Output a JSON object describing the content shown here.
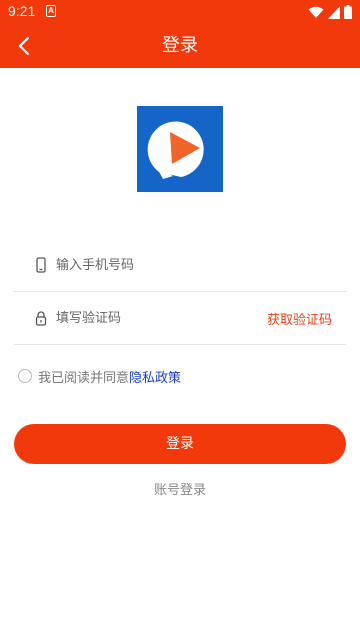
{
  "status_bar": {
    "time": "9:21",
    "notification_badge": "A"
  },
  "header": {
    "title": "登录",
    "background_color": "#f2390c"
  },
  "logo": {
    "icon": "play-logo-icon",
    "colors": {
      "tile": "#1565c8",
      "play": "#f0642a"
    }
  },
  "form": {
    "phone_placeholder": "输入手机号码",
    "code_placeholder": "填写验证码",
    "get_code_label": "获取验证码"
  },
  "agreement": {
    "text": "我已阅读并同意",
    "link": "隐私政策",
    "checked": false
  },
  "buttons": {
    "login_label": "登录",
    "account_login_label": "账号登录"
  },
  "colors": {
    "accent": "#f2390c",
    "link": "#1a3fd1"
  }
}
